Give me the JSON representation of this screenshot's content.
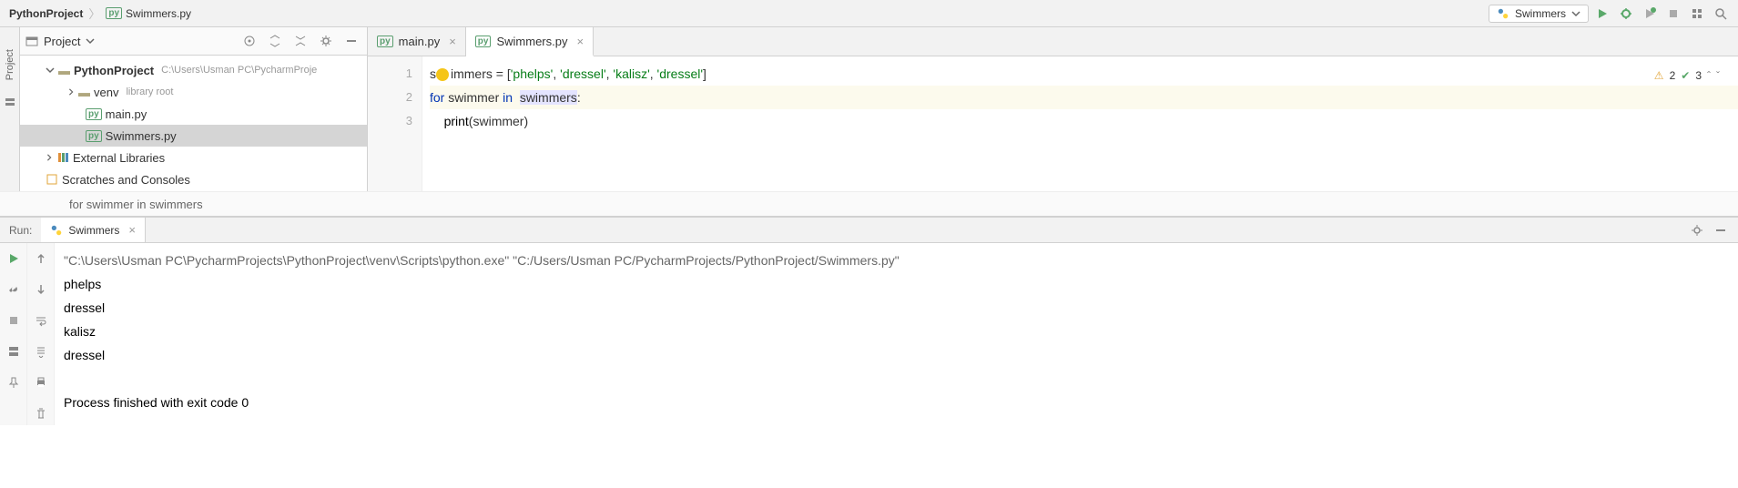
{
  "breadcrumb": {
    "project": "PythonProject",
    "file": "Swimmers.py"
  },
  "run_config": {
    "label": "Swimmers"
  },
  "sidebar": {
    "project_tab": "Project"
  },
  "project_panel": {
    "title": "Project",
    "root": "PythonProject",
    "root_path": "C:\\Users\\Usman PC\\PycharmProje",
    "venv": "venv",
    "venv_hint": "library root",
    "file_main": "main.py",
    "file_swimmers": "Swimmers.py",
    "ext_libs": "External Libraries",
    "scratches": "Scratches and Consoles"
  },
  "editor": {
    "tabs": {
      "main": "main.py",
      "swimmers": "Swimmers.py"
    },
    "gutter": [
      "1",
      "2",
      "3"
    ],
    "code": {
      "l1_pre": "s",
      "l1_var": "immers",
      "l1_eq": " = [",
      "l1_s1": "'phelps'",
      "l1_c1": ", ",
      "l1_s2": "'dressel'",
      "l1_c2": ", ",
      "l1_s3": "'kalisz'",
      "l1_c3": ", ",
      "l1_s4": "'dressel'",
      "l1_end": "]",
      "l2_for": "for",
      "l2_sp1": " ",
      "l2_swimmer": "swimmer",
      "l2_sp2": " ",
      "l2_in": "in",
      "l2_sp3": "  ",
      "l2_swimmers": "swimmers",
      "l2_colon": ":",
      "l3_indent": "    ",
      "l3_print": "print",
      "l3_open": "(",
      "l3_arg": "swimmer",
      "l3_close": ")"
    },
    "context": "for swimmer in swimmers",
    "warnings": "2",
    "checks": "3"
  },
  "run": {
    "label": "Run:",
    "tab": "Swimmers",
    "cmd": "\"C:\\Users\\Usman PC\\PycharmProjects\\PythonProject\\venv\\Scripts\\python.exe\" \"C:/Users/Usman PC/PycharmProjects/PythonProject/Swimmers.py\"",
    "out1": "phelps",
    "out2": "dressel",
    "out3": "kalisz",
    "out4": "dressel",
    "proc": "Process finished with exit code 0"
  }
}
